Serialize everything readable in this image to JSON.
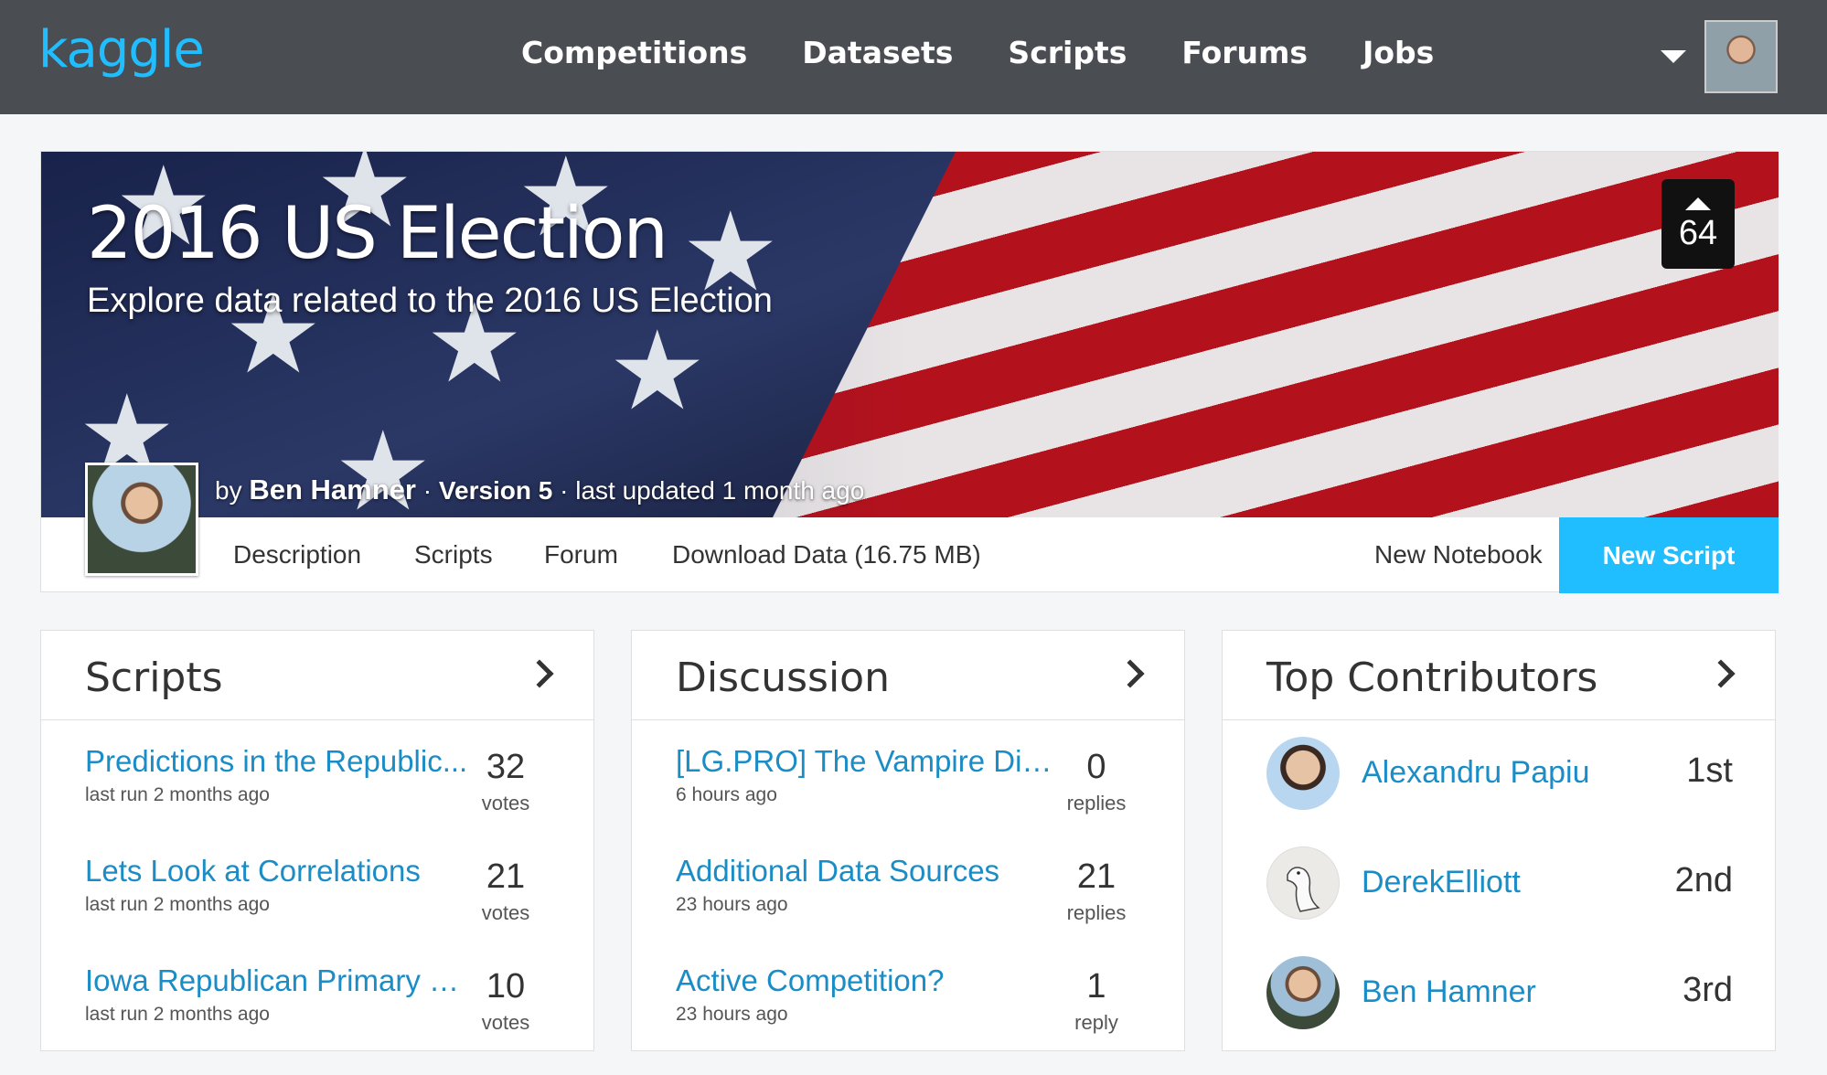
{
  "header": {
    "logo": "kaggle",
    "nav": [
      "Competitions",
      "Datasets",
      "Scripts",
      "Forums",
      "Jobs"
    ]
  },
  "dataset": {
    "title": "2016 US Election",
    "subtitle": "Explore data related to the 2016 US Election",
    "votes": "64",
    "by": "by",
    "author": "Ben Hamner",
    "sep1": " · ",
    "version": "Version 5",
    "updated": " · last updated 1 month ago"
  },
  "tabs": {
    "description": "Description",
    "scripts": "Scripts",
    "forum": "Forum",
    "download": "Download Data (16.75 MB)",
    "new_notebook": "New Notebook",
    "new_script": "New Script"
  },
  "scripts_card": {
    "title": "Scripts",
    "items": [
      {
        "title": "Predictions in the Republic...",
        "sub": "last run 2 months ago",
        "count": "32",
        "unit": "votes"
      },
      {
        "title": "Lets Look at Correlations",
        "sub": "last run 2 months ago",
        "count": "21",
        "unit": "votes"
      },
      {
        "title": "Iowa Republican Primary R...",
        "sub": "last run 2 months ago",
        "count": "10",
        "unit": "votes"
      }
    ]
  },
  "discussion_card": {
    "title": "Discussion",
    "items": [
      {
        "title": "[LG.PRO] The Vampire Dia...",
        "sub": "6 hours ago",
        "count": "0",
        "unit": "replies"
      },
      {
        "title": "Additional Data Sources",
        "sub": "23 hours ago",
        "count": "21",
        "unit": "replies"
      },
      {
        "title": "Active Competition?",
        "sub": "23 hours ago",
        "count": "1",
        "unit": "reply"
      }
    ]
  },
  "contributors_card": {
    "title": "Top Contributors",
    "items": [
      {
        "name": "Alexandru Papiu",
        "rank": "1st"
      },
      {
        "name": "DerekElliott",
        "rank": "2nd"
      },
      {
        "name": "Ben Hamner",
        "rank": "3rd"
      }
    ]
  },
  "colors": {
    "topbar": "#4a4d52",
    "accent": "#20beff",
    "link": "#1b8dc6"
  }
}
